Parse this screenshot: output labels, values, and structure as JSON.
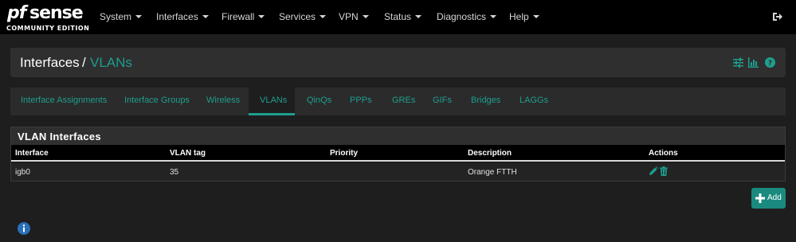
{
  "brand": {
    "logo_pf": "pf",
    "logo_sense": "sense",
    "edition": "COMMUNITY EDITION"
  },
  "nav": {
    "items": [
      "System",
      "Interfaces",
      "Firewall",
      "Services",
      "VPN",
      "Status",
      "Diagnostics",
      "Help"
    ]
  },
  "header": {
    "section": "Interfaces",
    "separator": "/",
    "page": "VLANs"
  },
  "tabs": [
    "Interface Assignments",
    "Interface Groups",
    "Wireless",
    "VLANs",
    "QinQs",
    "PPPs",
    "GREs",
    "GIFs",
    "Bridges",
    "LAGGs"
  ],
  "active_tab": "VLANs",
  "panel": {
    "title": "VLAN Interfaces",
    "columns": [
      "Interface",
      "VLAN tag",
      "Priority",
      "Description",
      "Actions"
    ],
    "rows": [
      {
        "interface": "igb0",
        "vlan_tag": "35",
        "priority": "",
        "description": "Orange FTTH"
      }
    ]
  },
  "add_button": {
    "label": "Add"
  },
  "colors": {
    "accent": "#1e9e8e",
    "button": "#1a8a7e",
    "navbar": "#000000",
    "background": "#1e1e1e",
    "info": "#2a6fb8"
  }
}
